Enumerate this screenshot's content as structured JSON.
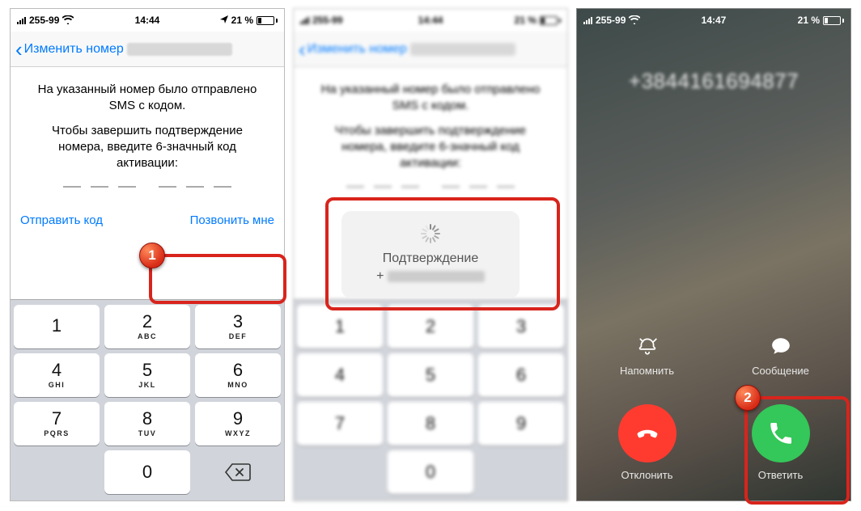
{
  "badges": {
    "one": "1",
    "two": "2"
  },
  "phone1": {
    "status": {
      "carrier": "255-99",
      "time": "14:44",
      "battery_pct": "21 %"
    },
    "nav": {
      "back_label": "Изменить номер"
    },
    "sms": {
      "line1": "На указанный номер было отправлено SMS с кодом.",
      "line2": "Чтобы завершить подтверждение номера, введите 6-значный код активации:"
    },
    "actions": {
      "resend": "Отправить код",
      "call_me": "Позвонить мне"
    },
    "keypad": [
      {
        "n": "1",
        "ltr": ""
      },
      {
        "n": "2",
        "ltr": "ABC"
      },
      {
        "n": "3",
        "ltr": "DEF"
      },
      {
        "n": "4",
        "ltr": "GHI"
      },
      {
        "n": "5",
        "ltr": "JKL"
      },
      {
        "n": "6",
        "ltr": "MNO"
      },
      {
        "n": "7",
        "ltr": "PQRS"
      },
      {
        "n": "8",
        "ltr": "TUV"
      },
      {
        "n": "9",
        "ltr": "WXYZ"
      },
      {
        "n": "",
        "ltr": ""
      },
      {
        "n": "0",
        "ltr": ""
      },
      {
        "n": "⌫",
        "ltr": ""
      }
    ]
  },
  "phone2": {
    "modal": {
      "title": "Подтверждение",
      "prefix": "+"
    }
  },
  "phone3": {
    "status": {
      "carrier": "255-99",
      "time": "14:47",
      "battery_pct": "21 %"
    },
    "caller_number": "+3844161694877",
    "buttons": {
      "remind": "Напомнить",
      "message": "Сообщение",
      "decline": "Отклонить",
      "answer": "Ответить"
    }
  }
}
